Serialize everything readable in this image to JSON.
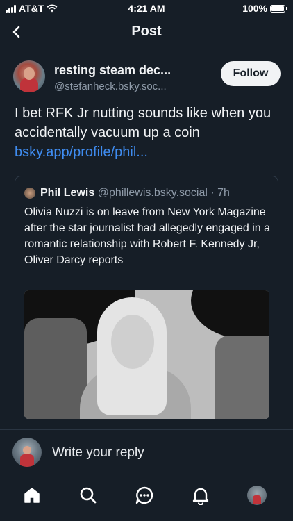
{
  "status_bar": {
    "carrier": "AT&T",
    "time": "4:21 AM",
    "battery": "100%"
  },
  "header": {
    "title": "Post"
  },
  "post": {
    "author_name": "resting steam dec...",
    "author_handle": "@stefanheck.bsky.soc...",
    "follow_label": "Follow",
    "text": "I bet RFK Jr nutting sounds like when you accidentally vacuum up a coin",
    "link_text": "bsky.app/profile/phil..."
  },
  "quote": {
    "author_name": "Phil Lewis",
    "author_handle": "@phillewis.bsky.social",
    "separator": " · ",
    "time": "7h",
    "text": "Olivia Nuzzi is on leave from New York Magazine after the star journalist had allegedly engaged in a romantic relationship with Robert F. Kennedy Jr, Oliver Darcy reports"
  },
  "reply": {
    "placeholder": "Write your reply"
  },
  "tabbar": {
    "items": [
      {
        "icon": "home-icon"
      },
      {
        "icon": "search-icon"
      },
      {
        "icon": "chat-icon"
      },
      {
        "icon": "bell-icon"
      },
      {
        "icon": "profile-avatar"
      }
    ]
  },
  "colors": {
    "background": "#161e27",
    "link": "#3f8cf0",
    "muted_text": "#8e9aa8",
    "border": "#2a3542"
  }
}
